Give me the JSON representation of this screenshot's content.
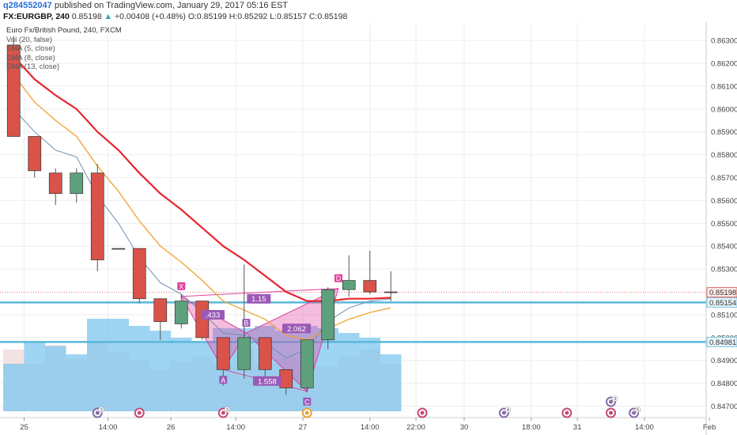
{
  "header": {
    "username": "q284552047",
    "published_text": "published on TradingView.com, January 29, 2017 05:16 EST",
    "symbol": "FX:EURGBP, 240",
    "last": "0.85198",
    "arrow": "▲",
    "change": "+0.00408 (+0.48%)",
    "o_label": "O:",
    "o_val": "0.85199",
    "h_label": "H:",
    "h_val": "0.85292",
    "l_label": "L:",
    "l_val": "0.85157",
    "c_label": "C:",
    "c_val": "0.85198"
  },
  "legend": {
    "title": "Euro Fx/British Pound, 240, FXCM",
    "items": [
      "Vol (20, false)",
      "EMA (5, close)",
      "EMA (8, close)",
      "EMA (13, close)"
    ]
  },
  "colors": {
    "bull": "#5fa07c",
    "bear": "#d9534a",
    "ema5": "#6f8fb0",
    "ema8": "#f0a030",
    "ema13": "#e8262d",
    "pattern": "#e040a0",
    "hline": "#5ab7d9",
    "volume": "#7ec7ef",
    "grid": "#eeeeee"
  },
  "chart_data": {
    "type": "candlestick",
    "ylim": [
      0.8465,
      0.8638
    ],
    "y_ticks": [
      "0.86300",
      "0.86200",
      "0.86100",
      "0.86000",
      "0.85900",
      "0.85800",
      "0.85700",
      "0.85600",
      "0.85500",
      "0.85400",
      "0.85300",
      "0.85100",
      "0.85000",
      "0.84900",
      "0.84800",
      "0.84700"
    ],
    "x_ticks": [
      {
        "label": "25",
        "i": 0.5
      },
      {
        "label": "14:00",
        "i": 4.5
      },
      {
        "label": "26",
        "i": 7.5
      },
      {
        "label": "14:00",
        "i": 10.6
      },
      {
        "label": "27",
        "i": 13.8
      },
      {
        "label": "14:00",
        "i": 17.0
      },
      {
        "label": "22:00",
        "i": 19.2
      },
      {
        "label": "30",
        "i": 21.5
      },
      {
        "label": "18:00",
        "i": 24.7
      },
      {
        "label": "31",
        "i": 26.9
      },
      {
        "label": "14:00",
        "i": 30.1
      },
      {
        "label": "Feb",
        "i": 33.2
      }
    ],
    "candles": [
      {
        "o": 0.8628,
        "h": 0.8632,
        "l": 0.8588,
        "c": 0.8588
      },
      {
        "o": 0.8588,
        "h": 0.8588,
        "l": 0.857,
        "c": 0.8573
      },
      {
        "o": 0.8572,
        "h": 0.8574,
        "l": 0.8558,
        "c": 0.8563
      },
      {
        "o": 0.8563,
        "h": 0.8574,
        "l": 0.8559,
        "c": 0.8572
      },
      {
        "o": 0.8572,
        "h": 0.8576,
        "l": 0.8529,
        "c": 0.8534
      },
      {
        "o": 0.8539,
        "h": 0.8539,
        "l": 0.8539,
        "c": 0.8539
      },
      {
        "o": 0.8539,
        "h": 0.8539,
        "l": 0.8515,
        "c": 0.8517
      },
      {
        "o": 0.8517,
        "h": 0.8517,
        "l": 0.8499,
        "c": 0.8507
      },
      {
        "o": 0.8506,
        "h": 0.8519,
        "l": 0.8504,
        "c": 0.8516
      },
      {
        "o": 0.8516,
        "h": 0.8516,
        "l": 0.8499,
        "c": 0.85
      },
      {
        "o": 0.85,
        "h": 0.85,
        "l": 0.8479,
        "c": 0.8486
      },
      {
        "o": 0.8486,
        "h": 0.8532,
        "l": 0.8482,
        "c": 0.85
      },
      {
        "o": 0.85,
        "h": 0.85,
        "l": 0.848,
        "c": 0.8486
      },
      {
        "o": 0.8486,
        "h": 0.8486,
        "l": 0.8475,
        "c": 0.8478
      },
      {
        "o": 0.8478,
        "h": 0.8499,
        "l": 0.8476,
        "c": 0.8499
      },
      {
        "o": 0.8499,
        "h": 0.8522,
        "l": 0.8495,
        "c": 0.8521
      },
      {
        "o": 0.8521,
        "h": 0.8536,
        "l": 0.8518,
        "c": 0.8525
      },
      {
        "o": 0.8525,
        "h": 0.8538,
        "l": 0.8519,
        "c": 0.852
      },
      {
        "o": 0.852,
        "h": 0.8529,
        "l": 0.8516,
        "c": 0.85198
      }
    ],
    "volume": [
      0.4,
      0.58,
      0.55,
      0.48,
      0.78,
      0.78,
      0.72,
      0.68,
      0.62,
      0.58,
      0.7,
      0.7,
      0.72,
      0.68,
      0.72,
      0.7,
      0.66,
      0.62,
      0.48
    ],
    "volume_bg": [
      0.52,
      0.4,
      0.56,
      0.44,
      0.58,
      0.5,
      0.43,
      0.35,
      0.42,
      0.46,
      0.4,
      0.52,
      0.4,
      0.44,
      0.38,
      0.38,
      0.46,
      0.52,
      0.4
    ],
    "ema5": [
      0.86,
      0.859,
      0.8582,
      0.8579,
      0.8562,
      0.855,
      0.8535,
      0.8524,
      0.8519,
      0.8511,
      0.8502,
      0.8501,
      0.8498,
      0.8491,
      0.8495,
      0.8507,
      0.8513,
      0.8516,
      0.8517
    ],
    "ema8": [
      0.8615,
      0.8603,
      0.8595,
      0.8588,
      0.8575,
      0.8564,
      0.8551,
      0.854,
      0.8533,
      0.8525,
      0.8516,
      0.8512,
      0.8508,
      0.8501,
      0.8499,
      0.8504,
      0.8508,
      0.8511,
      0.8513
    ],
    "ema13": [
      0.8623,
      0.8613,
      0.8606,
      0.86,
      0.859,
      0.8582,
      0.8572,
      0.8563,
      0.8556,
      0.8548,
      0.854,
      0.8534,
      0.8527,
      0.852,
      0.8516,
      0.8516,
      0.8517,
      0.8517,
      0.85175
    ],
    "hlines": [
      {
        "value": 0.85154,
        "label": "0.85154"
      },
      {
        "value": 0.84981,
        "label": "0.84981"
      }
    ],
    "last_price": {
      "value": 0.85198,
      "label": "0.85198"
    },
    "pattern": {
      "points": [
        {
          "label": "X",
          "i": 8.0,
          "v": 0.8518
        },
        {
          "label": "A",
          "i": 10.0,
          "v": 0.8486
        },
        {
          "label": "B",
          "i": 11.1,
          "v": 0.8502
        },
        {
          "label": "C",
          "i": 14.0,
          "v": 0.84765
        },
        {
          "label": "D",
          "i": 15.5,
          "v": 0.85215
        }
      ],
      "ratios": [
        {
          "label": ".433",
          "i": 9.5,
          "v": 0.851
        },
        {
          "label": "1.15",
          "i": 11.7,
          "v": 0.8517
        },
        {
          "label": "1.558",
          "i": 12.1,
          "v": 0.8481
        },
        {
          "label": "2.062",
          "i": 13.5,
          "v": 0.8504
        }
      ]
    },
    "events": [
      {
        "i": 4.0,
        "type": "flag",
        "badge": "3"
      },
      {
        "i": 6.0,
        "type": "uk",
        "badge": ""
      },
      {
        "i": 10.0,
        "type": "uk",
        "badge": "3"
      },
      {
        "i": 14.0,
        "type": "eu",
        "badge": ""
      },
      {
        "i": 19.5,
        "type": "uk",
        "badge": ""
      },
      {
        "i": 23.4,
        "type": "flag",
        "badge": "4"
      },
      {
        "i": 26.4,
        "type": "uk",
        "badge": ""
      },
      {
        "i": 28.5,
        "type": "uk",
        "badge": ""
      },
      {
        "i": 28.5,
        "type": "flag",
        "badge": "3",
        "row": 1
      },
      {
        "i": 29.6,
        "type": "flag",
        "badge": "5"
      }
    ]
  }
}
